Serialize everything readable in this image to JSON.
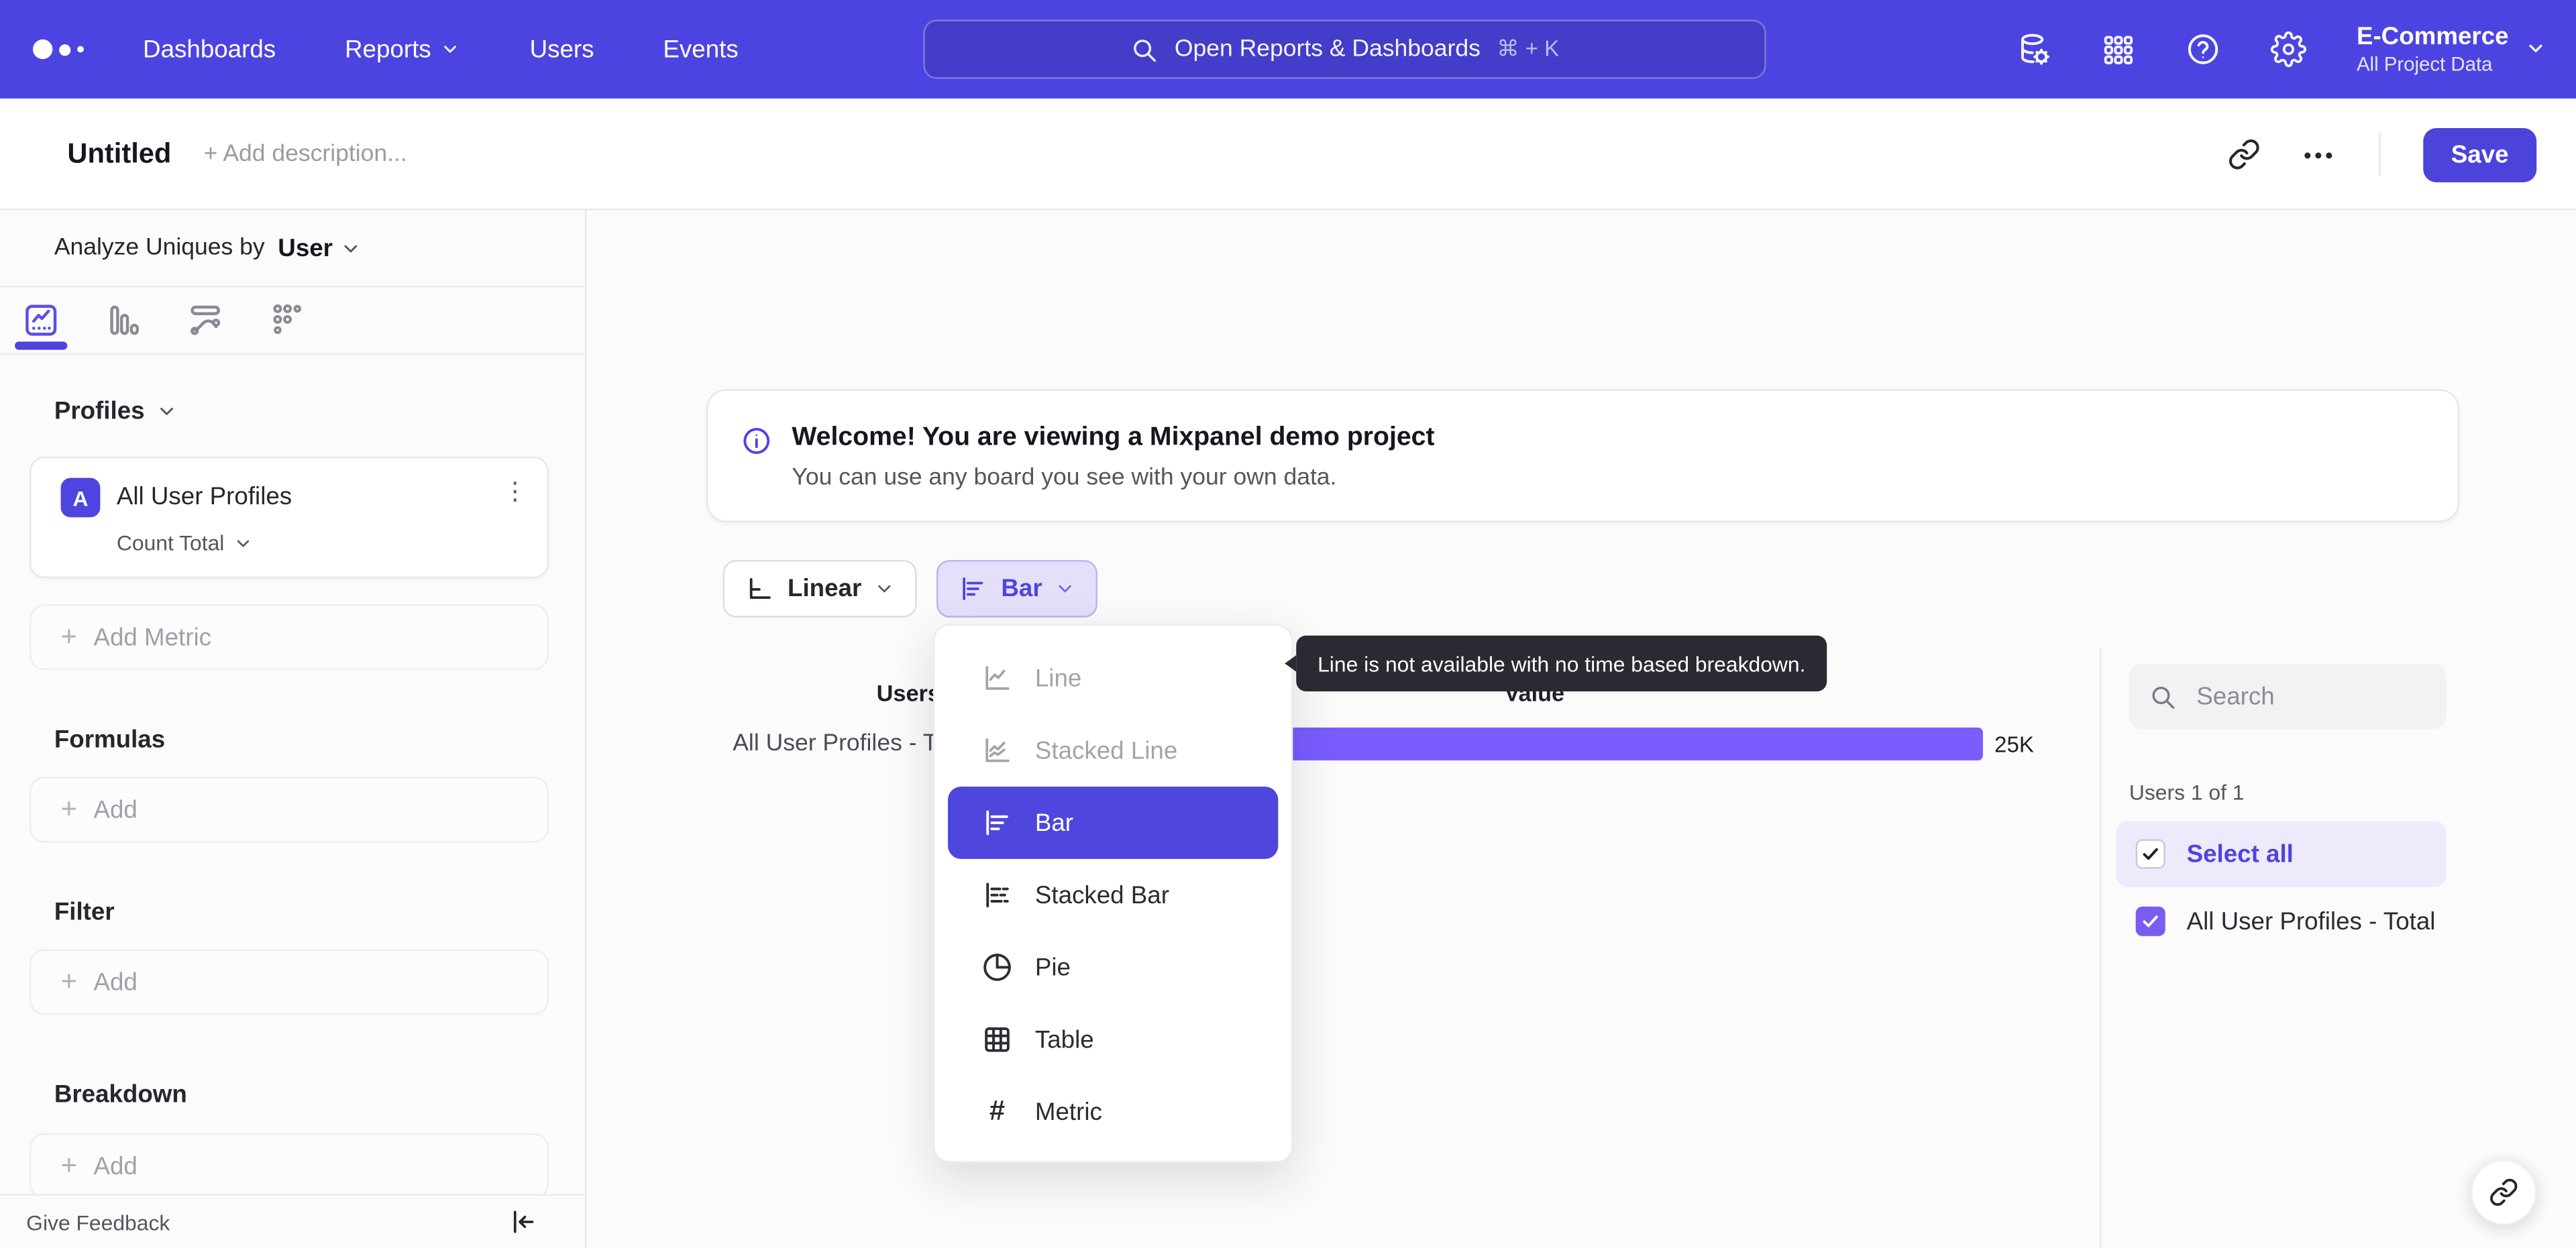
{
  "topnav": {
    "items": [
      {
        "label": "Dashboards"
      },
      {
        "label": "Reports",
        "has_dropdown": true
      },
      {
        "label": "Users"
      },
      {
        "label": "Events"
      }
    ],
    "search": {
      "placeholder": "Open Reports & Dashboards",
      "shortcut": "⌘ + K"
    },
    "project": {
      "name": "E-Commerce",
      "scope": "All Project Data"
    }
  },
  "titlebar": {
    "title": "Untitled",
    "description_placeholder": "+ Add description...",
    "save_label": "Save"
  },
  "sidebar": {
    "analyze": {
      "label": "Analyze Uniques by",
      "value": "User"
    },
    "profiles_label": "Profiles",
    "metric_card": {
      "badge": "A",
      "name": "All User Profiles",
      "aggregation": "Count Total"
    },
    "add_metric_label": "Add Metric",
    "sections": [
      {
        "title": "Formulas",
        "add_label": "Add"
      },
      {
        "title": "Filter",
        "add_label": "Add"
      },
      {
        "title": "Breakdown",
        "add_label": "Add"
      }
    ],
    "footer": {
      "feedback_label": "Give Feedback"
    }
  },
  "banner": {
    "title": "Welcome! You are viewing a Mixpanel demo project",
    "subtitle": "You can use any board you see with your own data."
  },
  "controls": {
    "scale_label": "Linear",
    "chart_type_label": "Bar"
  },
  "chart_menu": {
    "items": [
      {
        "label": "Line",
        "state": "disabled"
      },
      {
        "label": "Stacked Line",
        "state": "disabled"
      },
      {
        "label": "Bar",
        "state": "selected"
      },
      {
        "label": "Stacked Bar",
        "state": "normal"
      },
      {
        "label": "Pie",
        "state": "normal"
      },
      {
        "label": "Table",
        "state": "normal"
      },
      {
        "label": "Metric",
        "state": "normal"
      }
    ]
  },
  "tooltip": {
    "text": "Line is not available with no time based breakdown."
  },
  "chart_data": {
    "type": "bar",
    "orientation": "horizontal",
    "columns": [
      "Users",
      "Value"
    ],
    "categories": [
      "All User Profiles - Total"
    ],
    "values": [
      25000
    ],
    "value_labels": [
      "25K"
    ],
    "series": [
      {
        "name": "All User Profiles - Total",
        "values": [
          25000
        ]
      }
    ],
    "bar_color": "#7a5cff"
  },
  "right_panel": {
    "search_placeholder": "Search",
    "count_label": "Users 1 of 1",
    "select_all_label": "Select all",
    "items": [
      {
        "label": "All User Profiles - Total",
        "checked": true
      }
    ]
  },
  "icons": {
    "more_horizontal": "•••",
    "more_vertical": "⋮",
    "plus": "+",
    "hash": "#"
  },
  "colors": {
    "nav_bg": "#4c44e0",
    "accent": "#4f44e0",
    "bar_fill": "#7a5cff",
    "selected_menu_bg": "#4e46dd",
    "tooltip_bg": "#2a2a32",
    "page_bg": "#fbfbfc"
  }
}
